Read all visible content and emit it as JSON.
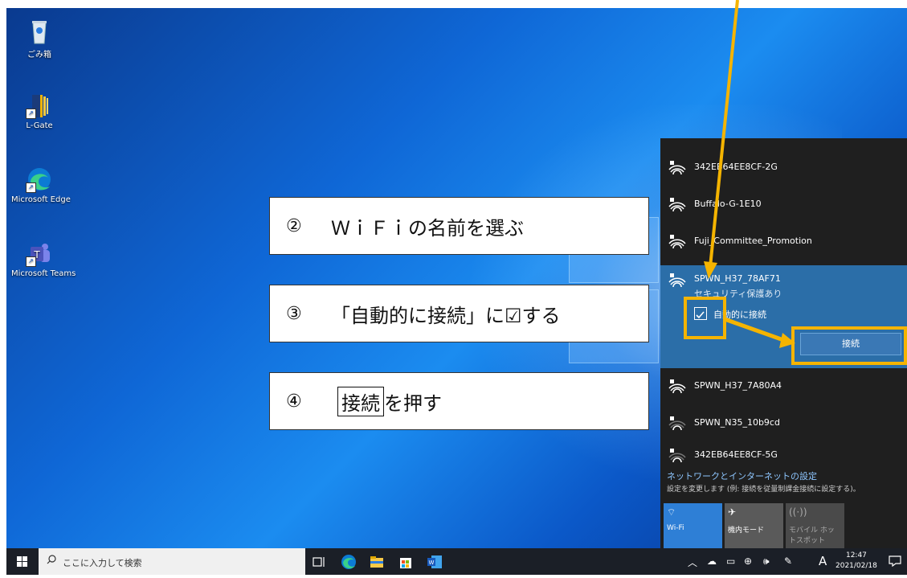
{
  "desktop_icons": [
    {
      "label": "ごみ箱"
    },
    {
      "label": "L-Gate"
    },
    {
      "label": "Microsoft Edge"
    },
    {
      "label": "Microsoft Teams"
    }
  ],
  "callouts": [
    {
      "num": "②",
      "text": "ＷｉＦｉの名前を選ぶ"
    },
    {
      "num": "③",
      "text": "「自動的に接続」に☑する"
    },
    {
      "num": "④",
      "boxed": "接続",
      "text": "を押す"
    }
  ],
  "wifi_panel": {
    "networks": [
      {
        "name": "342EB64EE8CF-2G"
      },
      {
        "name": "Buffalo-G-1E10"
      },
      {
        "name": "Fuji_Committee_Promotion"
      },
      {
        "name": "SPWN_H37_78AF71",
        "status": "セキュリティ保護あり",
        "auto_connect_label": "自動的に接続",
        "auto_connect_checked": true,
        "connect_label": "接続"
      },
      {
        "name": "SPWN_H37_7A80A4"
      },
      {
        "name": "SPWN_N35_10b9cd"
      },
      {
        "name": "342EB64EE8CF-5G"
      }
    ],
    "settings_title": "ネットワークとインターネットの設定",
    "settings_desc": "設定を変更します (例: 接続を従量制課金接続に設定する)。",
    "tiles": [
      {
        "label": "Wi-Fi",
        "active": true
      },
      {
        "label": "機内モード",
        "active": false
      },
      {
        "label": "モバイル ホットスポット",
        "active": false
      }
    ]
  },
  "taskbar": {
    "search_placeholder": "ここに入力して検索",
    "clock_time": "12:47",
    "clock_date": "2021/02/18",
    "ime": "A"
  },
  "colors": {
    "annotation": "#f5b400",
    "panel_bg": "#1f1f1f",
    "selected_bg": "#2b6ea8",
    "accent": "#2e7fd6"
  }
}
